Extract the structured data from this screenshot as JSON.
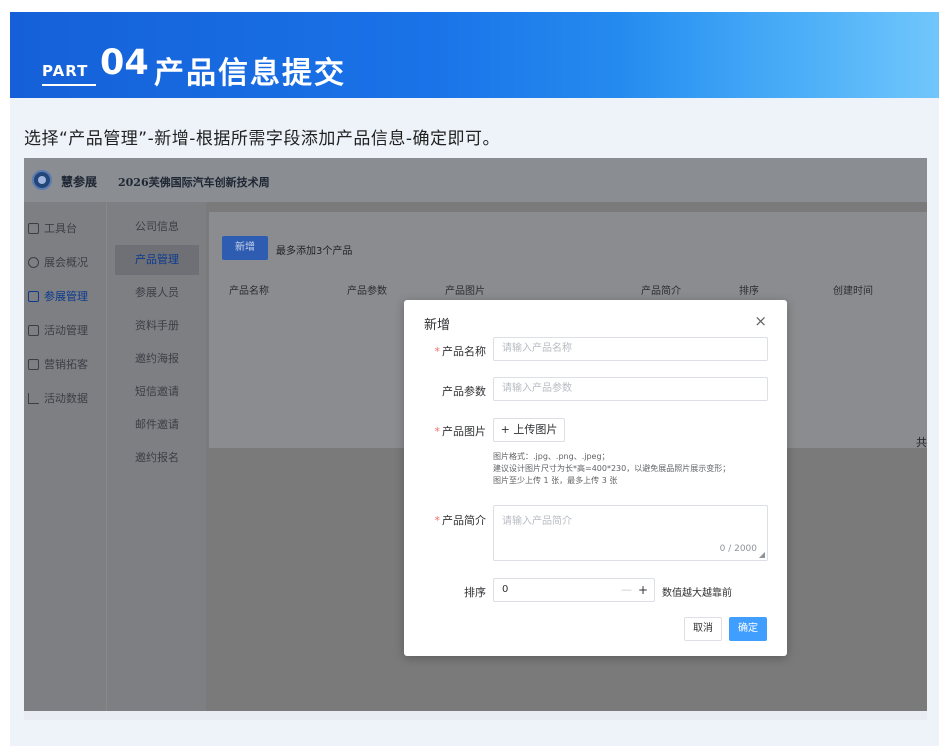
{
  "banner": {
    "part": "PART",
    "number": "04",
    "title": "产品信息提交"
  },
  "caption": "选择“产品管理”-新增-根据所需字段添加产品信息-确定即可。",
  "app": {
    "brand": "慧参展",
    "event_title": "2026芙佛国际汽车创新技术周",
    "nav_primary": [
      "工具台",
      "展会概况",
      "参展管理",
      "活动管理",
      "营销拓客",
      "活动数据"
    ],
    "nav_primary_active": "参展管理",
    "nav_secondary": [
      "公司信息",
      "产品管理",
      "参展人员",
      "资料手册",
      "邀约海报",
      "短信邀请",
      "邮件邀请",
      "邀约报名"
    ],
    "nav_secondary_active": "产品管理",
    "add_button": "新增",
    "add_note": "最多添加3个产品",
    "table_headers": [
      "产品名称",
      "产品参数",
      "产品图片",
      "产品简介",
      "排序",
      "创建时间"
    ],
    "pager_fragment": "共"
  },
  "modal": {
    "title": "新增",
    "close": "×",
    "fields": {
      "name_label": "产品名称",
      "name_placeholder": "请输入产品名称",
      "params_label": "产品参数",
      "params_placeholder": "请输入产品参数",
      "image_label": "产品图片",
      "upload_button": "+ 上传图片",
      "hint_1": "图片格式：.jpg、.png、.jpeg；",
      "hint_2": "建议设计图片尺寸为长*高=400*230，以避免展品照片展示变形；",
      "hint_3": "图片至少上传 1 张，最多上传 3 张",
      "intro_label": "产品简介",
      "intro_placeholder": "请输入产品简介",
      "intro_counter": "0 / 2000",
      "sort_label": "排序",
      "sort_value": "0",
      "sort_minus": "—",
      "sort_plus": "+",
      "sort_note": "数值越大越靠前",
      "required_mark": "*"
    },
    "cancel": "取消",
    "confirm": "确定"
  }
}
